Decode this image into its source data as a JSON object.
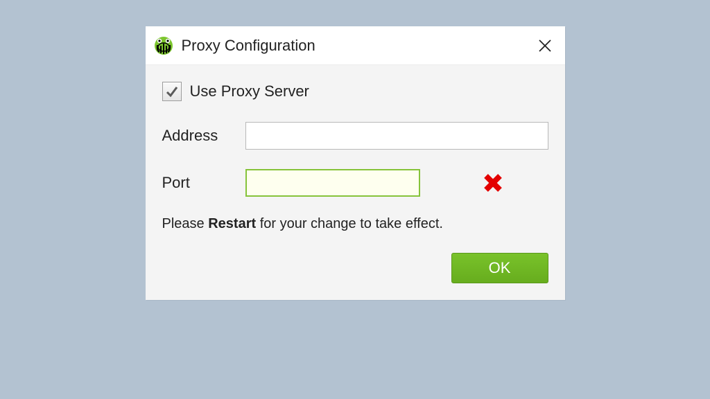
{
  "window": {
    "title": "Proxy Configuration"
  },
  "form": {
    "use_proxy_label": "Use Proxy Server",
    "use_proxy_checked": true,
    "address_label": "Address",
    "address_value": "",
    "port_label": "Port",
    "port_value": "",
    "port_has_error": true,
    "hint_prefix": "Please ",
    "hint_bold": "Restart",
    "hint_suffix": " for your change to take effect."
  },
  "buttons": {
    "ok_label": "OK"
  },
  "colors": {
    "accent_green": "#6fb728",
    "error_red": "#e30000"
  }
}
